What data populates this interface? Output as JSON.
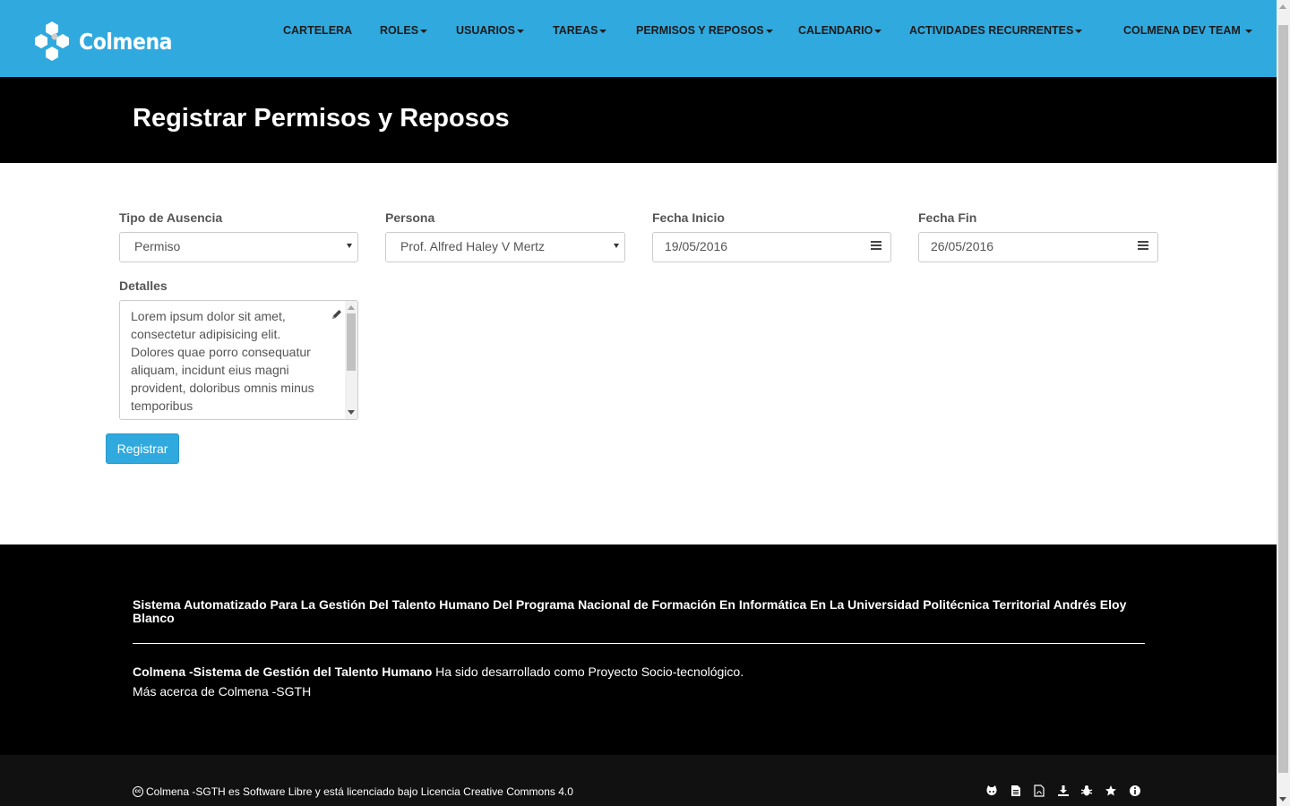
{
  "brand": {
    "name": "Colmena"
  },
  "nav": {
    "items": [
      {
        "label": "CARTELERA",
        "dropdown": false
      },
      {
        "label": "ROLES",
        "dropdown": true
      },
      {
        "label": "USUARIOS",
        "dropdown": true
      },
      {
        "label": "TAREAS",
        "dropdown": true
      },
      {
        "label": "PERMISOS Y REPOSOS",
        "dropdown": true
      },
      {
        "label": "CALENDARIO",
        "dropdown": true
      },
      {
        "label": "ACTIVIDADES RECURRENTES",
        "dropdown": true
      }
    ],
    "user_menu": "COLMENA DEV TEAM"
  },
  "page": {
    "title": "Registrar Permisos y Reposos"
  },
  "form": {
    "tipo": {
      "label": "Tipo de Ausencia",
      "value": "Permiso"
    },
    "persona": {
      "label": "Persona",
      "value": "Prof. Alfred Haley V Mertz"
    },
    "fecha_inicio": {
      "label": "Fecha Inicio",
      "value": "19/05/2016"
    },
    "fecha_fin": {
      "label": "Fecha Fin",
      "value": "26/05/2016"
    },
    "detalles": {
      "label": "Detalles",
      "value": "Lorem ipsum dolor sit amet, consectetur adipisicing elit. Dolores quae porro consequatur aliquam, incidunt eius magni provident, doloribus omnis minus temporibus"
    },
    "submit_label": "Registrar"
  },
  "footer": {
    "heading": "Sistema Automatizado Para La Gestión Del Talento Humano Del Programa Nacional de Formación En Informática En La Universidad Politécnica Territorial Andrés Eloy Blanco",
    "app_name": "Colmena -Sistema de Gestión del Talento Humano",
    "app_desc": " Ha sido desarrollado como Proyecto Socio-tecnológico.",
    "more_link": "Más acerca de Colmena -SGTH",
    "license": "Colmena -SGTH es Software Libre y está licenciado bajo Licencia Creative Commons 4.0",
    "icons": [
      "github-icon",
      "document-icon",
      "pdf-icon",
      "download-icon",
      "bug-icon",
      "star-icon",
      "info-icon"
    ]
  },
  "colors": {
    "primary": "#30a9de",
    "dark": "#000000"
  }
}
